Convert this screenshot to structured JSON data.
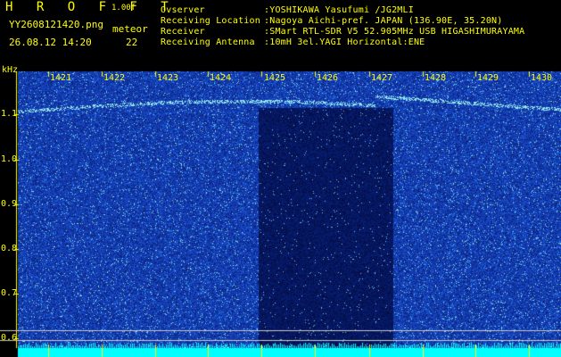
{
  "header": {
    "brand": "H R O F F T",
    "version": "1.00f",
    "filename": "YY2608121420.png",
    "datetime": "26.08.12 14:20",
    "detection_label": "meteor",
    "detection_count": "22"
  },
  "station": {
    "observer_label": "Ovserver",
    "observer_value": ":YOSHIKAWA Yasufumi /JG2MLI",
    "location_label": "Receiving Location",
    "location_value": ":Nagoya Aichi-pref. JAPAN (136.90E, 35.20N)",
    "receiver_label": "Receiver",
    "receiver_value": ":SMart RTL-SDR V5 52.905MHz USB HIGASHIMURAYAMA",
    "antenna_label": "Receiving Antenna",
    "antenna_value": ":10mH 3el.YAGI Horizontal:ENE"
  },
  "plot": {
    "y_unit": "kHz",
    "y_ticks": [
      "1.1",
      "1.0",
      "0.9",
      "0.8",
      "0.7",
      "0.6"
    ],
    "time_ticks": [
      "1421",
      "1422",
      "1423",
      "1424",
      "1425",
      "1426",
      "1427",
      "1428",
      "1429",
      "1430"
    ]
  },
  "colors": {
    "text": "#ffff00",
    "background": "#000000",
    "noise_floor": "#1e2fb8",
    "signal": "#00e5ff",
    "baseline": "#00ffff"
  }
}
